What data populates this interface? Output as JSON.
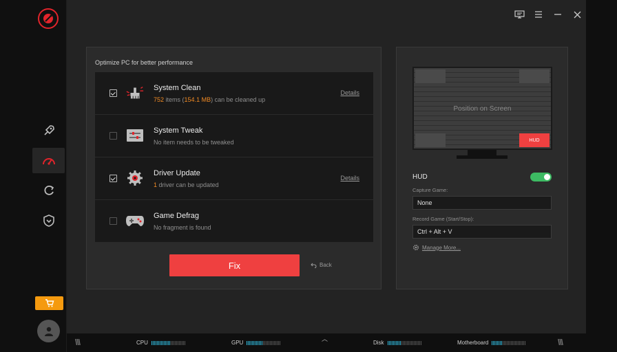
{
  "optimize": {
    "title": "Optimize PC for better performance",
    "items": [
      {
        "title": "System Clean",
        "sub_pre": "752",
        "sub_mid": " items (",
        "sub_hl2": "154.1 MB",
        "sub_post": ") can be cleaned up",
        "checked": true,
        "details": "Details"
      },
      {
        "title": "System Tweak",
        "sub": "No item needs to be tweaked",
        "checked": false
      },
      {
        "title": "Driver Update",
        "sub_pre": "1",
        "sub_post": " driver can be updated",
        "checked": true,
        "details": "Details"
      },
      {
        "title": "Game Defrag",
        "sub": "No fragment is found",
        "checked": false
      }
    ],
    "fix_label": "Fix",
    "back_label": "Back"
  },
  "hud": {
    "monitor_text": "Position on Screen",
    "active_slot_label": "HUD",
    "label": "HUD",
    "enabled": true,
    "capture_label": "Capture Game:",
    "capture_value": "None",
    "record_label": "Record Game (Start/Stop):",
    "record_value": "Ctrl + Alt + V",
    "manage_label": "Manage More..."
  },
  "status": {
    "cpu_label": "CPU",
    "cpu_level": 0.55,
    "gpu_label": "GPU",
    "gpu_level": 0.45,
    "disk_label": "Disk",
    "disk_level": 0.4,
    "mb_label": "Motherboard",
    "mb_level": 0.3
  },
  "colors": {
    "accent": "#ef4040",
    "warn": "#f08a24",
    "toggle_on": "#3dbb63",
    "cart": "#f59a0f"
  }
}
